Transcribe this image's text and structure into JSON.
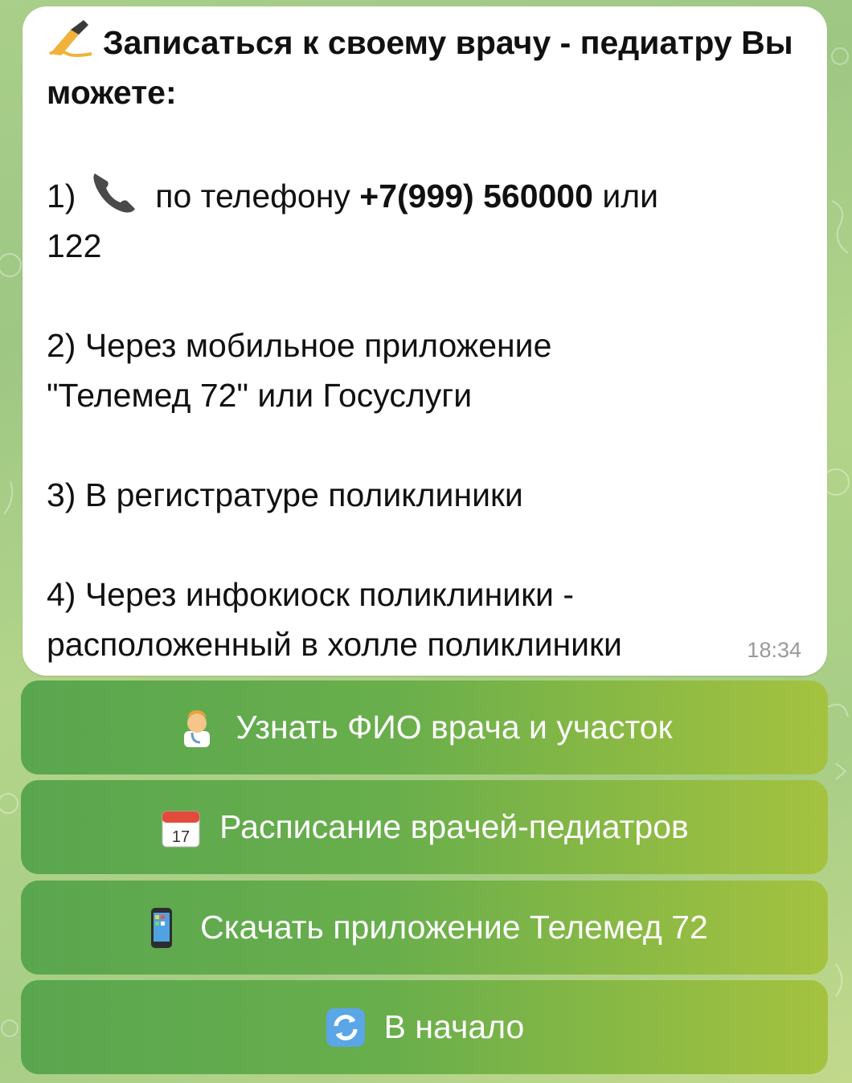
{
  "message": {
    "title": "Записаться к своему врачу - педиатру Вы можете:",
    "title_icon": "writing-hand-icon",
    "item1_prefix": "1)",
    "item1_icon": "telephone-receiver-icon",
    "item1_text": "по телефону",
    "item1_phone": "+7(999) 560000",
    "item1_suffix_line1": "или",
    "item1_suffix_line2": "122",
    "item2_line1": "2) Через мобильное приложение",
    "item2_line2": "\"Телемед 72\" или Госуслуги",
    "item3": "3) В регистратуре поликлиники",
    "item4_line1": "4) Через инфокиоск поликлиники -",
    "item4_line2": "расположенный в холле поликлиники",
    "time": "18:34"
  },
  "buttons": [
    {
      "label": "Узнать ФИО врача и участок",
      "icon": "doctor-icon"
    },
    {
      "label": "Расписание врачей-педиатров",
      "icon": "calendar-icon",
      "icon_text": "17"
    },
    {
      "label": "Скачать приложение Телемед 72",
      "icon": "mobile-phone-icon"
    },
    {
      "label": "В начало",
      "icon": "refresh-icon"
    }
  ]
}
